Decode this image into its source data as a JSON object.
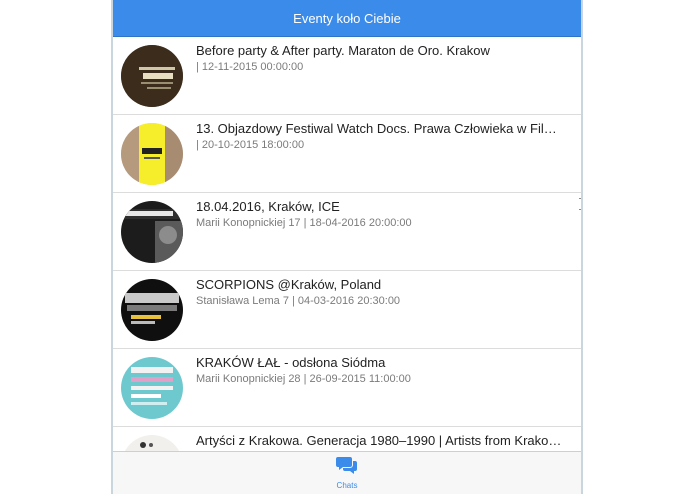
{
  "header": {
    "title": "Eventy koło Ciebie"
  },
  "events": [
    {
      "title": "Before party & After party. Maraton de Oro. Krakow",
      "meta": "| 12-11-2015 00:00:00",
      "thumb": "event-poster-maraton-de-oro"
    },
    {
      "title": "13. Objazdowy Festiwal Watch Docs. Prawa Człowieka w Fil…",
      "meta": "| 20-10-2015 18:00:00",
      "thumb": "event-poster-watch-docs"
    },
    {
      "title": "18.04.2016, Kraków, ICE",
      "meta": "Marii Konopnickiej 17 | 18-04-2016 20:00:00",
      "thumb": "event-poster-steven-wilson"
    },
    {
      "title": "SCORPIONS @Kraków, Poland",
      "meta": "Stanisława Lema 7 | 04-03-2016 20:30:00",
      "thumb": "event-poster-scorpions"
    },
    {
      "title": "KRAKÓW ŁAŁ - odsłona Siódma",
      "meta": "Marii Konopnickiej 28 | 26-09-2015 11:00:00",
      "thumb": "event-poster-krakow-lal"
    },
    {
      "title": "Artyści z Krakowa. Generacja 1980–1990 | Artists from Krako…",
      "meta": "",
      "thumb": "event-poster-artysci"
    }
  ],
  "tabbar": {
    "chats_label": "Chats",
    "chats_icon": "chat-bubbles-icon"
  },
  "colors": {
    "accent": "#3b8beb"
  }
}
